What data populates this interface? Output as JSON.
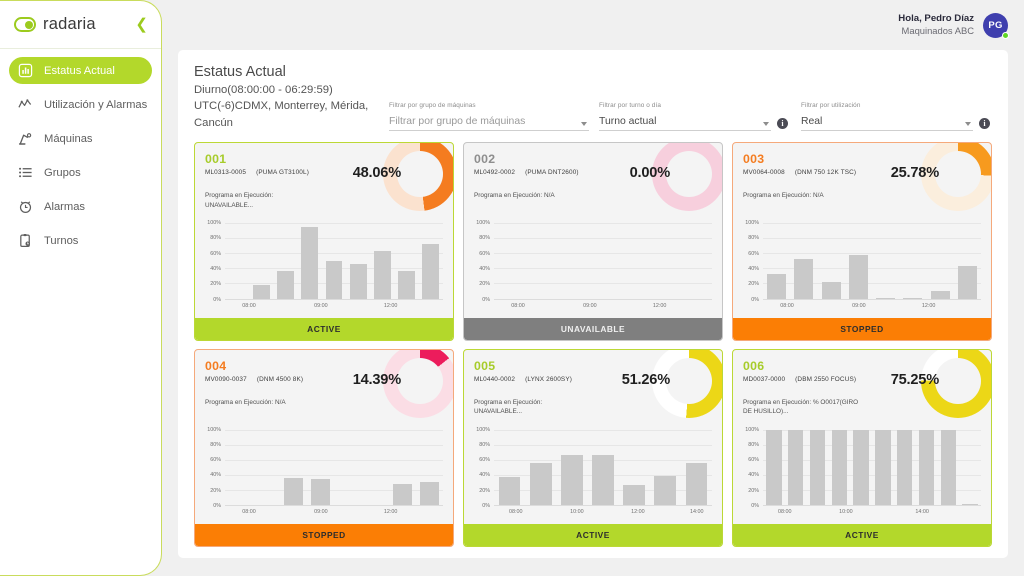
{
  "brand": {
    "name": "radaria",
    "logo_icon": "radaria-logo-icon",
    "collapse_icon": "chevron-left-icon"
  },
  "sidebar": {
    "items": [
      {
        "label": "Estatus Actual",
        "icon": "dashboard-icon",
        "active": true
      },
      {
        "label": "Utilización y Alarmas",
        "icon": "trend-line-icon",
        "active": false
      },
      {
        "label": "Máquinas",
        "icon": "robot-arm-icon",
        "active": false
      },
      {
        "label": "Grupos",
        "icon": "list-icon",
        "active": false
      },
      {
        "label": "Alarmas",
        "icon": "alarm-clock-icon",
        "active": false
      },
      {
        "label": "Turnos",
        "icon": "clipboard-clock-icon",
        "active": false
      }
    ]
  },
  "topbar": {
    "greeting": "Hola, Pedro Díaz",
    "org": "Maquinados ABC",
    "avatar_initials": "PG",
    "online_status_icon": "online-dot-icon"
  },
  "header": {
    "title": "Estatus Actual",
    "shift": "Diurno(08:00:00 - 06:29:59)",
    "timezone": "UTC(-6)CDMX, Monterrey, Mérida, Cancún"
  },
  "filters": [
    {
      "label": "Filtrar por grupo de máquinas",
      "value": "",
      "placeholder": "Filtrar por grupo de máquinas",
      "has_info": false,
      "options": [
        "Filtrar por grupo de máquinas"
      ]
    },
    {
      "label": "Filtrar por turno o día",
      "value": "Turno actual",
      "placeholder": "",
      "has_info": true,
      "options": [
        "Turno actual"
      ]
    },
    {
      "label": "Filtrar por utilización",
      "value": "Real",
      "placeholder": "",
      "has_info": true,
      "options": [
        "Real"
      ]
    }
  ],
  "colors": {
    "brand_green": "#9ccb1e",
    "active": "#b3d82b",
    "stopped": "#fb7e05",
    "unavailable": "#7f7f7f",
    "donut_yellow": "#ecd717",
    "donut_orange": "#f47c20",
    "donut_pink": "#ec1c5c",
    "avatar": "#3f3fae"
  },
  "cards": [
    {
      "machine_id": "001",
      "serial": "ML0313-0005",
      "model": "(PUMA GT3100L)",
      "program_label": "Programa en Ejecución:",
      "program_value": "UNAVAILABLE...",
      "utilization": "48.06%",
      "utilization_value": 48.06,
      "status": "ACTIVE",
      "status_key": "st-active",
      "id_color_class": "c-active",
      "donut_color": "#f47c20",
      "donut_track": "#fbe2cf",
      "chart_data": {
        "type": "bar",
        "title": "Utilización 001",
        "xlabel": "",
        "ylabel": "",
        "ylim": [
          0,
          100
        ],
        "grid": true,
        "yticks": [
          "100%",
          "80%",
          "60%",
          "40%",
          "20%",
          "0%"
        ],
        "xticks": [
          {
            "label": "08:00",
            "pos": 11
          },
          {
            "label": "09:00",
            "pos": 44
          },
          {
            "label": "12:00",
            "pos": 76
          }
        ],
        "values": [
          0,
          18,
          37,
          95,
          50,
          46,
          63,
          36,
          72
        ]
      }
    },
    {
      "machine_id": "002",
      "serial": "ML0492-0002",
      "model": "(PUMA DNT2600)",
      "program_label": "Programa en Ejecución: N/A",
      "program_value": "",
      "utilization": "0.00%",
      "utilization_value": 0.0,
      "status": "UNAVAILABLE",
      "status_key": "st-unavail",
      "id_color_class": "c-unavail",
      "donut_color": "#f7cfdd",
      "donut_track": "#f7cfdd",
      "chart_data": {
        "type": "bar",
        "title": "Utilización 002",
        "xlabel": "",
        "ylabel": "",
        "ylim": [
          0,
          100
        ],
        "grid": true,
        "yticks": [
          "100%",
          "80%",
          "60%",
          "40%",
          "20%",
          "0%"
        ],
        "xticks": [
          {
            "label": "08:00",
            "pos": 11
          },
          {
            "label": "09:00",
            "pos": 44
          },
          {
            "label": "12:00",
            "pos": 76
          }
        ],
        "values": [
          0,
          0,
          0,
          0,
          0,
          0,
          0,
          0,
          0
        ]
      }
    },
    {
      "machine_id": "003",
      "serial": "MV0064-0008",
      "model": "(DNM 750 12K TSC)",
      "program_label": "Programa en Ejecución: N/A",
      "program_value": "",
      "utilization": "25.78%",
      "utilization_value": 25.78,
      "status": "STOPPED",
      "status_key": "st-stopped",
      "id_color_class": "c-stopped",
      "donut_color": "#f79a1e",
      "donut_track": "#fbeedd",
      "chart_data": {
        "type": "bar",
        "title": "Utilización 003",
        "xlabel": "",
        "ylabel": "",
        "ylim": [
          0,
          100
        ],
        "grid": true,
        "yticks": [
          "100%",
          "80%",
          "60%",
          "40%",
          "20%",
          "0%"
        ],
        "xticks": [
          {
            "label": "08:00",
            "pos": 11
          },
          {
            "label": "09:00",
            "pos": 44
          },
          {
            "label": "12:00",
            "pos": 76
          }
        ],
        "values": [
          32,
          53,
          22,
          58,
          1,
          1,
          10,
          43
        ]
      }
    },
    {
      "machine_id": "004",
      "serial": "MV0090-0037",
      "model": "(DNM 4500 8K)",
      "program_label": "Programa en Ejecución: N/A",
      "program_value": "",
      "utilization": "14.39%",
      "utilization_value": 14.39,
      "status": "STOPPED",
      "status_key": "st-stopped",
      "id_color_class": "c-stopped",
      "donut_color": "#ec1c5c",
      "donut_track": "#fbdde5",
      "chart_data": {
        "type": "bar",
        "title": "Utilización 004",
        "xlabel": "",
        "ylabel": "",
        "ylim": [
          0,
          100
        ],
        "grid": true,
        "yticks": [
          "100%",
          "80%",
          "60%",
          "40%",
          "20%",
          "0%"
        ],
        "xticks": [
          {
            "label": "08:00",
            "pos": 11
          },
          {
            "label": "09:00",
            "pos": 44
          },
          {
            "label": "12:00",
            "pos": 76
          }
        ],
        "values": [
          0,
          0,
          36,
          35,
          0,
          0,
          28,
          30
        ]
      }
    },
    {
      "machine_id": "005",
      "serial": "ML0440-0002",
      "model": "(LYNX 2600SY)",
      "program_label": "Programa en Ejecución:",
      "program_value": "UNAVAILABLE...",
      "utilization": "51.26%",
      "utilization_value": 51.26,
      "status": "ACTIVE",
      "status_key": "st-active",
      "id_color_class": "c-active",
      "donut_color": "#ecd717",
      "donut_track": "#ffffff",
      "chart_data": {
        "type": "bar",
        "title": "Utilización 005",
        "xlabel": "",
        "ylabel": "",
        "ylim": [
          0,
          100
        ],
        "grid": true,
        "yticks": [
          "100%",
          "80%",
          "60%",
          "40%",
          "20%",
          "0%"
        ],
        "xticks": [
          {
            "label": "08:00",
            "pos": 10
          },
          {
            "label": "10:00",
            "pos": 38
          },
          {
            "label": "12:00",
            "pos": 66
          },
          {
            "label": "14:00",
            "pos": 93
          }
        ],
        "values": [
          37,
          55,
          66,
          66,
          27,
          38,
          56
        ]
      }
    },
    {
      "machine_id": "006",
      "serial": "MD0037-0000",
      "model": "(DBM 2550 FOCUS)",
      "program_label": "Programa en Ejecución: % O0017(GIRO",
      "program_value": "DE HUSILLO)...",
      "utilization": "75.25%",
      "utilization_value": 75.25,
      "status": "ACTIVE",
      "status_key": "st-active",
      "id_color_class": "c-active",
      "donut_color": "#ecd717",
      "donut_track": "#ffffff",
      "chart_data": {
        "type": "bar",
        "title": "Utilización 006",
        "xlabel": "",
        "ylabel": "",
        "ylim": [
          0,
          100
        ],
        "grid": true,
        "yticks": [
          "100%",
          "80%",
          "60%",
          "40%",
          "20%",
          "0%"
        ],
        "xticks": [
          {
            "label": "08:00",
            "pos": 10
          },
          {
            "label": "10:00",
            "pos": 38
          },
          {
            "label": "14:00",
            "pos": 73
          }
        ],
        "values": [
          100,
          100,
          100,
          100,
          100,
          100,
          100,
          100,
          100,
          1
        ]
      }
    }
  ]
}
